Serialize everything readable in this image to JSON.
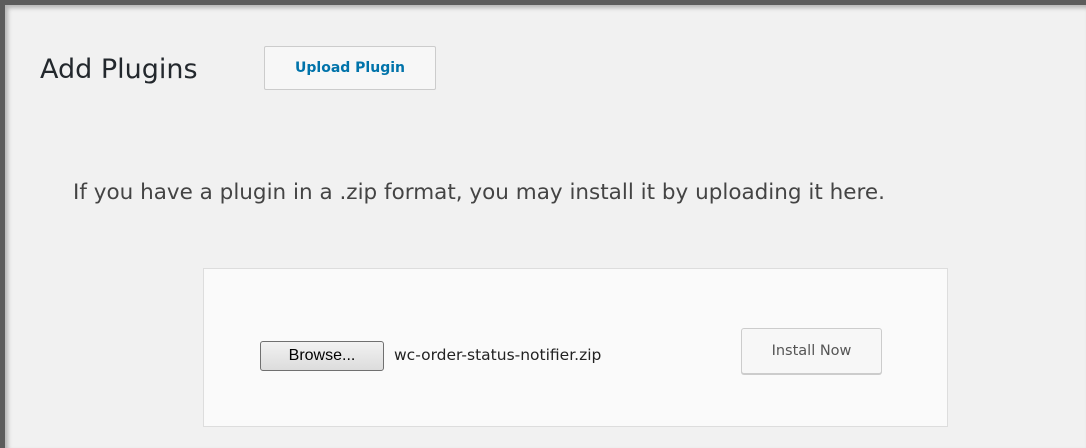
{
  "header": {
    "title": "Add Plugins",
    "upload_plugin_label": "Upload Plugin"
  },
  "upload_section": {
    "description": "If you have a plugin in a .zip format, you may install it by uploading it here.",
    "browse_label": "Browse...",
    "selected_file": "wc-order-status-notifier.zip",
    "install_label": "Install Now"
  },
  "colors": {
    "background": "#f1f1f1",
    "link_blue": "#0073aa",
    "title_text": "#23282d",
    "body_text": "#444444"
  }
}
